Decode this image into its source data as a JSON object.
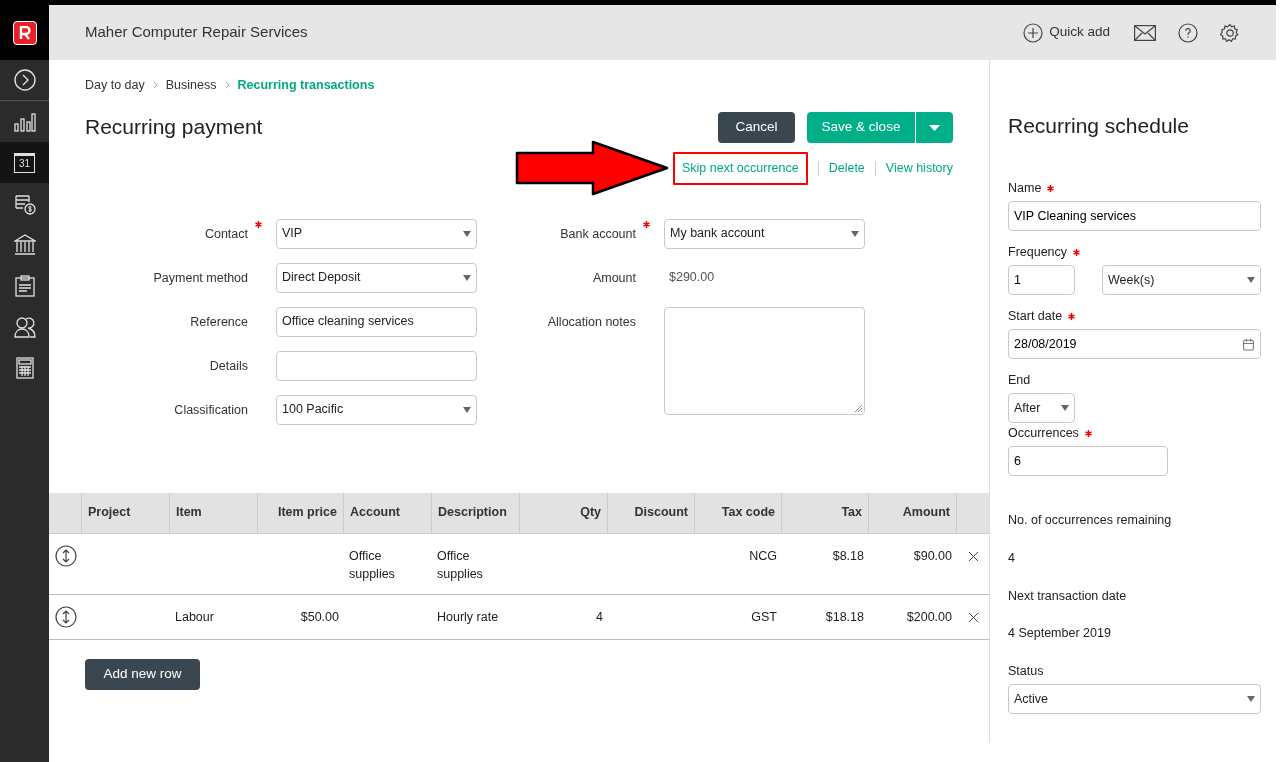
{
  "header": {
    "company": "Maher Computer Repair Services",
    "quick_add": "Quick add"
  },
  "sidebar": {
    "items": [
      {
        "selected": false
      },
      {
        "selected": false
      },
      {
        "selected": true,
        "text": "31"
      },
      {
        "selected": false
      },
      {
        "selected": false
      },
      {
        "selected": false
      },
      {
        "selected": false
      },
      {
        "selected": false
      }
    ]
  },
  "breadcrumb": [
    {
      "label": "Day to day",
      "current": false
    },
    {
      "label": "Business",
      "current": false
    },
    {
      "label": "Recurring transactions",
      "current": true
    }
  ],
  "page_title": "Recurring payment",
  "actions": {
    "cancel": "Cancel",
    "save": "Save & close",
    "links": [
      {
        "label": "Skip next occurrence",
        "highlighted": true
      },
      {
        "label": "Delete",
        "highlighted": false
      },
      {
        "label": "View history",
        "highlighted": false
      }
    ]
  },
  "form_left": [
    {
      "label": "Contact",
      "kind": "select",
      "value": "VIP",
      "required": true
    },
    {
      "label": "Payment method",
      "kind": "select",
      "value": "Direct Deposit",
      "required": false
    },
    {
      "label": "Reference",
      "kind": "text",
      "value": "Office cleaning services",
      "required": false
    },
    {
      "label": "Details",
      "kind": "text",
      "required": false
    },
    {
      "label": "Classification",
      "kind": "select",
      "value": "100 Pacific",
      "required": false
    }
  ],
  "form_right": [
    {
      "label": "Bank account",
      "kind": "select",
      "value": "My bank account",
      "required": true
    },
    {
      "label": "Amount",
      "kind": "static",
      "value": "$290.00",
      "required": false
    },
    {
      "label": "Allocation notes",
      "kind": "textarea",
      "required": false
    }
  ],
  "table": {
    "columns": [
      "Project",
      "Item",
      "Item price",
      "Account",
      "Description",
      "Qty",
      "Discount",
      "Tax code",
      "Tax",
      "Amount"
    ],
    "rows": [
      [
        "",
        "",
        "",
        "Office supplies",
        "Office supplies",
        "",
        "",
        "NCG",
        "$8.18",
        "$90.00"
      ],
      [
        "",
        "Labour",
        "$50.00",
        "",
        "Hourly rate",
        "4",
        "",
        "GST",
        "$18.18",
        "$200.00"
      ]
    ]
  },
  "add_row": "Add new row",
  "schedule": {
    "title": "Recurring schedule",
    "name": {
      "label": "Name",
      "value": "VIP Cleaning services"
    },
    "frequency": {
      "label": "Frequency",
      "number": "1",
      "unit": "Week(s)"
    },
    "start_date": {
      "label": "Start date",
      "value": "28/08/2019"
    },
    "end": {
      "label": "End",
      "value": "After"
    },
    "occurrences": {
      "label": "Occurrences",
      "value": "6"
    },
    "remaining": {
      "label": "No. of occurrences remaining",
      "value": "4"
    },
    "next_date": {
      "label": "Next transaction date",
      "value": "4 September 2019"
    },
    "status": {
      "label": "Status",
      "value": "Active"
    }
  }
}
